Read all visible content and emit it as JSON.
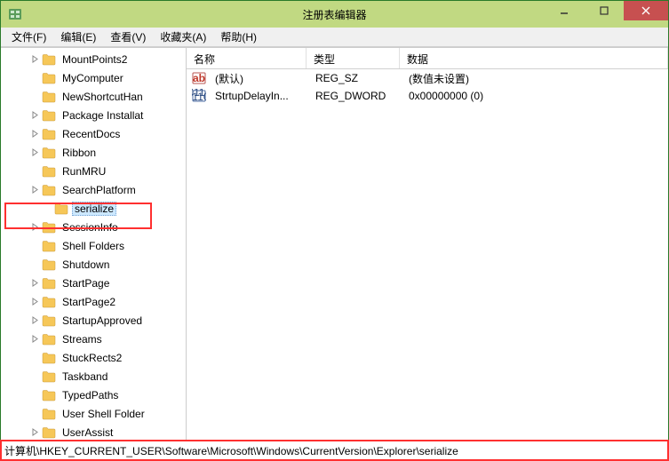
{
  "window": {
    "title": "注册表编辑器"
  },
  "menubar": [
    {
      "label": "文件(F)"
    },
    {
      "label": "编辑(E)"
    },
    {
      "label": "查看(V)"
    },
    {
      "label": "收藏夹(A)"
    },
    {
      "label": "帮助(H)"
    }
  ],
  "tree": {
    "items": [
      {
        "label": "MountPoints2",
        "expander": "right",
        "indent": 0
      },
      {
        "label": "MyComputer",
        "expander": "",
        "indent": 0
      },
      {
        "label": "NewShortcutHan",
        "expander": "",
        "indent": 0
      },
      {
        "label": "Package Installat",
        "expander": "right",
        "indent": 0
      },
      {
        "label": "RecentDocs",
        "expander": "right",
        "indent": 0
      },
      {
        "label": "Ribbon",
        "expander": "right",
        "indent": 0
      },
      {
        "label": "RunMRU",
        "expander": "",
        "indent": 0
      },
      {
        "label": "SearchPlatform",
        "expander": "right",
        "indent": 0
      },
      {
        "label": "serialize",
        "expander": "",
        "indent": 1,
        "selected": true
      },
      {
        "label": "SessionInfo",
        "expander": "right",
        "indent": 0
      },
      {
        "label": "Shell Folders",
        "expander": "",
        "indent": 0
      },
      {
        "label": "Shutdown",
        "expander": "",
        "indent": 0
      },
      {
        "label": "StartPage",
        "expander": "right",
        "indent": 0
      },
      {
        "label": "StartPage2",
        "expander": "right",
        "indent": 0
      },
      {
        "label": "StartupApproved",
        "expander": "right",
        "indent": 0
      },
      {
        "label": "Streams",
        "expander": "right",
        "indent": 0
      },
      {
        "label": "StuckRects2",
        "expander": "",
        "indent": 0
      },
      {
        "label": "Taskband",
        "expander": "",
        "indent": 0
      },
      {
        "label": "TypedPaths",
        "expander": "",
        "indent": 0
      },
      {
        "label": "User Shell Folder",
        "expander": "",
        "indent": 0
      },
      {
        "label": "UserAssist",
        "expander": "right",
        "indent": 0
      }
    ]
  },
  "list": {
    "headers": {
      "name": "名称",
      "type": "类型",
      "data": "数据"
    },
    "rows": [
      {
        "icon": "string",
        "name": "(默认)",
        "type": "REG_SZ",
        "data": "(数值未设置)"
      },
      {
        "icon": "binary",
        "name": "StrtupDelayIn...",
        "type": "REG_DWORD",
        "data": "0x00000000 (0)"
      }
    ]
  },
  "statusbar": {
    "path": "计算机\\HKEY_CURRENT_USER\\Software\\Microsoft\\Windows\\CurrentVersion\\Explorer\\serialize"
  }
}
